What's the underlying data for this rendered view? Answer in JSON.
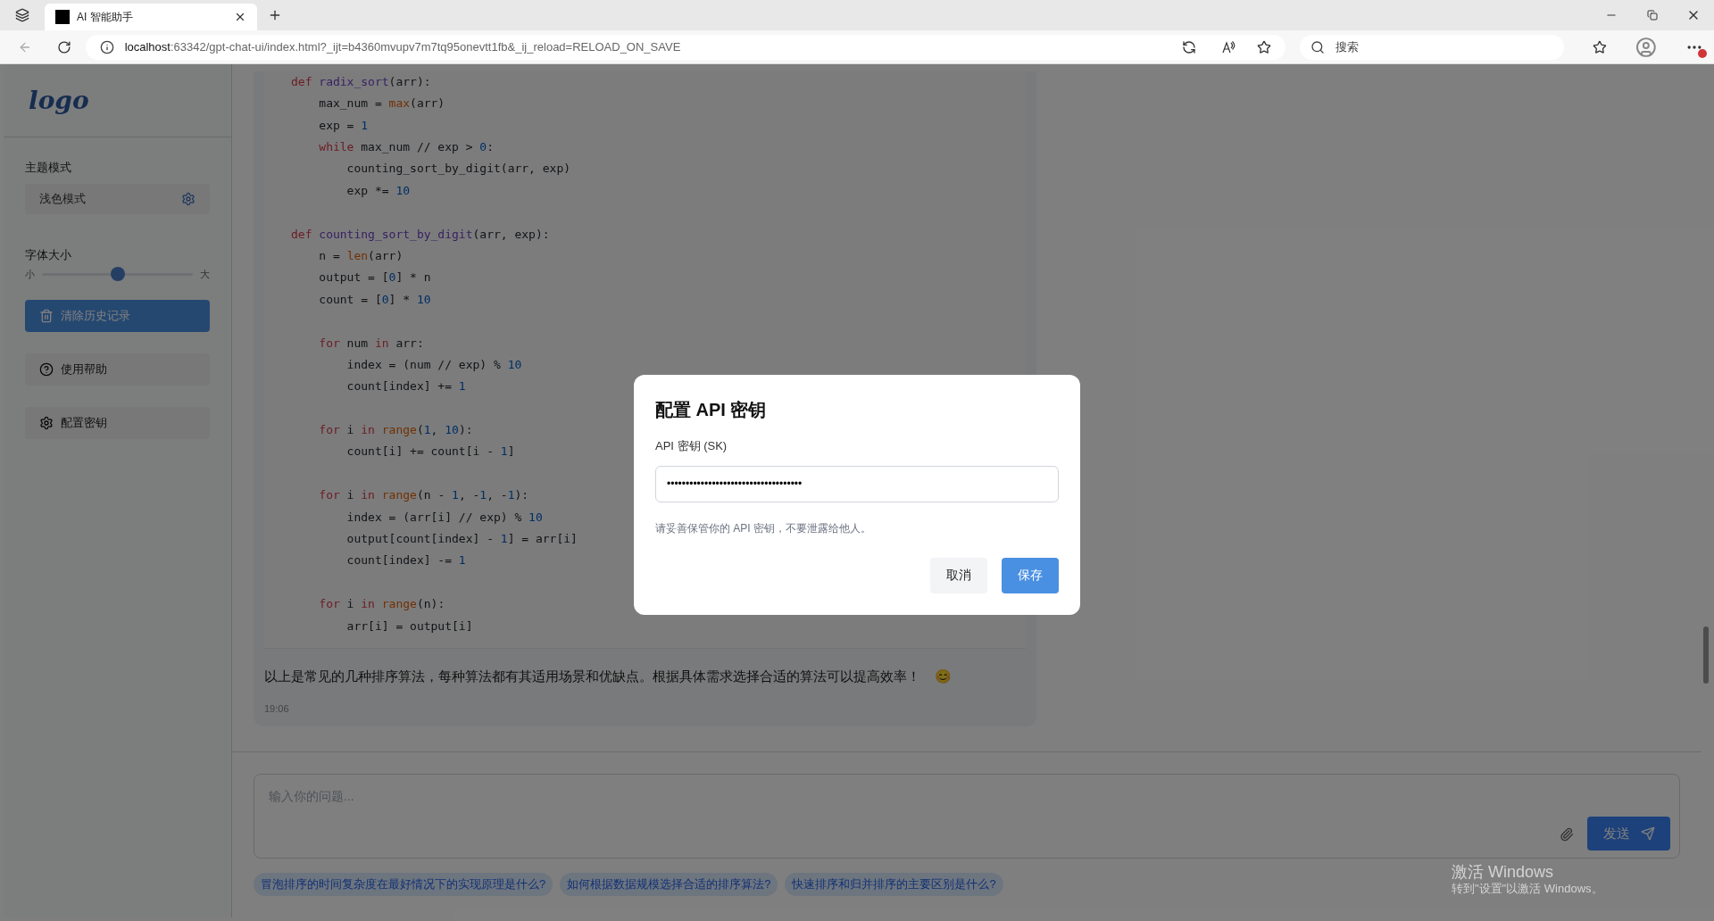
{
  "browser": {
    "tab": {
      "title": "AI 智能助手"
    },
    "address": {
      "host": "localhost",
      "path": ":63342/gpt-chat-ui/index.html?_ijt=b4360mvupv7m7tq95onevtt1fb&_ij_reload=RELOAD_ON_SAVE"
    },
    "search": {
      "placeholder": "搜索"
    }
  },
  "sidebar": {
    "logo": "logo",
    "theme": {
      "label": "主题模式",
      "value": "浅色模式"
    },
    "font_size": {
      "label": "字体大小",
      "min_label": "小",
      "max_label": "大",
      "level": 0.5
    },
    "clear_button": "清除历史记录",
    "items": [
      {
        "kind": "help",
        "label": "使用帮助"
      },
      {
        "kind": "key",
        "label": "配置密钥"
      }
    ]
  },
  "code": [
    [
      {
        "kind": "kw",
        "text": "def"
      },
      {
        "kind": "fn",
        "text": " radix_sort"
      },
      {
        "kind": "plain",
        "text": "(arr):"
      }
    ],
    [
      {
        "kind": "plain",
        "text": "    max_num = "
      },
      {
        "kind": "builtin",
        "text": "max"
      },
      {
        "kind": "plain",
        "text": "(arr)"
      }
    ],
    [
      {
        "kind": "plain",
        "text": "    exp = "
      },
      {
        "kind": "num",
        "text": "1"
      }
    ],
    [
      {
        "kind": "kw",
        "text": "    while"
      },
      {
        "kind": "plain",
        "text": " max_num // exp > "
      },
      {
        "kind": "num",
        "text": "0"
      },
      {
        "kind": "plain",
        "text": ":"
      }
    ],
    [
      {
        "kind": "plain",
        "text": "        counting_sort_by_digit(arr, exp)"
      }
    ],
    [
      {
        "kind": "plain",
        "text": "        exp *= "
      },
      {
        "kind": "num",
        "text": "10"
      }
    ],
    [
      {
        "kind": "blank"
      }
    ],
    [
      {
        "kind": "kw",
        "text": "def"
      },
      {
        "kind": "fn",
        "text": " counting_sort_by_digit"
      },
      {
        "kind": "plain",
        "text": "(arr, exp):"
      }
    ],
    [
      {
        "kind": "plain",
        "text": "    n = "
      },
      {
        "kind": "builtin",
        "text": "len"
      },
      {
        "kind": "plain",
        "text": "(arr)"
      }
    ],
    [
      {
        "kind": "plain",
        "text": "    output = ["
      },
      {
        "kind": "num",
        "text": "0"
      },
      {
        "kind": "plain",
        "text": "] * n"
      }
    ],
    [
      {
        "kind": "plain",
        "text": "    count = ["
      },
      {
        "kind": "num",
        "text": "0"
      },
      {
        "kind": "plain",
        "text": "] * "
      },
      {
        "kind": "num",
        "text": "10"
      }
    ],
    [
      {
        "kind": "blank"
      }
    ],
    [
      {
        "kind": "kw",
        "text": "    for"
      },
      {
        "kind": "plain",
        "text": " num "
      },
      {
        "kind": "kw",
        "text": "in"
      },
      {
        "kind": "plain",
        "text": " arr:"
      }
    ],
    [
      {
        "kind": "plain",
        "text": "        index = (num // exp) % "
      },
      {
        "kind": "num",
        "text": "10"
      }
    ],
    [
      {
        "kind": "plain",
        "text": "        count[index] += "
      },
      {
        "kind": "num",
        "text": "1"
      }
    ],
    [
      {
        "kind": "blank"
      }
    ],
    [
      {
        "kind": "kw",
        "text": "    for"
      },
      {
        "kind": "plain",
        "text": " i "
      },
      {
        "kind": "kw",
        "text": "in"
      },
      {
        "kind": "builtin",
        "text": " range"
      },
      {
        "kind": "plain",
        "text": "("
      },
      {
        "kind": "num",
        "text": "1"
      },
      {
        "kind": "plain",
        "text": ", "
      },
      {
        "kind": "num",
        "text": "10"
      },
      {
        "kind": "plain",
        "text": "):"
      }
    ],
    [
      {
        "kind": "plain",
        "text": "        count[i] += count[i - "
      },
      {
        "kind": "num",
        "text": "1"
      },
      {
        "kind": "plain",
        "text": "]"
      }
    ],
    [
      {
        "kind": "blank"
      }
    ],
    [
      {
        "kind": "kw",
        "text": "    for"
      },
      {
        "kind": "plain",
        "text": " i "
      },
      {
        "kind": "kw",
        "text": "in"
      },
      {
        "kind": "builtin",
        "text": " range"
      },
      {
        "kind": "plain",
        "text": "(n - "
      },
      {
        "kind": "num",
        "text": "1"
      },
      {
        "kind": "plain",
        "text": ", -"
      },
      {
        "kind": "num",
        "text": "1"
      },
      {
        "kind": "plain",
        "text": ", -"
      },
      {
        "kind": "num",
        "text": "1"
      },
      {
        "kind": "plain",
        "text": "):"
      }
    ],
    [
      {
        "kind": "plain",
        "text": "        index = (arr[i] // exp) % "
      },
      {
        "kind": "num",
        "text": "10"
      }
    ],
    [
      {
        "kind": "plain",
        "text": "        output[count[index] - "
      },
      {
        "kind": "num",
        "text": "1"
      },
      {
        "kind": "plain",
        "text": "] = arr[i]"
      }
    ],
    [
      {
        "kind": "plain",
        "text": "        count[index] -= "
      },
      {
        "kind": "num",
        "text": "1"
      }
    ],
    [
      {
        "kind": "blank"
      }
    ],
    [
      {
        "kind": "kw",
        "text": "    for"
      },
      {
        "kind": "plain",
        "text": " i "
      },
      {
        "kind": "kw",
        "text": "in"
      },
      {
        "kind": "builtin",
        "text": " range"
      },
      {
        "kind": "plain",
        "text": "(n):"
      }
    ],
    [
      {
        "kind": "plain",
        "text": "        arr[i] = output[i]"
      }
    ]
  ],
  "message": {
    "text": "以上是常见的几种排序算法，每种算法都有其适用场景和优缺点。根据具体需求选择合适的算法可以提高效率！",
    "emoji": "😊",
    "time": "19:06"
  },
  "composer": {
    "placeholder": "输入你的问题...",
    "send": "发送"
  },
  "suggestions": [
    "冒泡排序的时间复杂度在最好情况下的实现原理是什么?",
    "如何根据数据规模选择合适的排序算法?",
    "快速排序和归并排序的主要区别是什么?"
  ],
  "os_watermark": {
    "title": "激活 Windows",
    "hint": "转到\"设置\"以激活 Windows。"
  },
  "dialog": {
    "title": "配置 API 密钥",
    "field_label": "API 密钥 (SK)",
    "value": "••••••••••••••••••••••••••••••••••••",
    "note": "请妥善保管你的 API 密钥，不要泄露给他人。",
    "buttons": [
      {
        "kind": "cancel",
        "label": "取消"
      },
      {
        "kind": "primary",
        "label": "保存"
      }
    ]
  }
}
